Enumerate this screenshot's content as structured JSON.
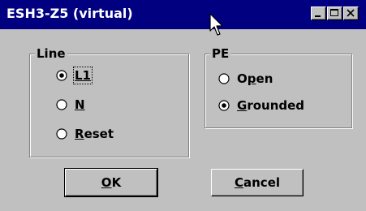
{
  "window": {
    "title": "ESH3-Z5 (virtual)",
    "controls": [
      "minimize-icon",
      "maximize-icon",
      "close-icon"
    ]
  },
  "line_group": {
    "title": "Line",
    "options": [
      {
        "prefix": "",
        "mnemonic": "L1",
        "suffix": "",
        "selected": true
      },
      {
        "prefix": "",
        "mnemonic": "N",
        "suffix": "",
        "selected": false
      },
      {
        "prefix": "",
        "mnemonic": "R",
        "suffix": "eset",
        "selected": false
      }
    ]
  },
  "pe_group": {
    "title": "PE",
    "options": [
      {
        "prefix": "O",
        "mnemonic": "p",
        "suffix": "en",
        "selected": false
      },
      {
        "prefix": "",
        "mnemonic": "G",
        "suffix": "rounded",
        "selected": true
      }
    ]
  },
  "buttons": {
    "ok": {
      "mnemonic": "O",
      "rest": "K"
    },
    "cancel": {
      "mnemonic": "C",
      "rest": "ancel"
    }
  },
  "colors": {
    "title_bar": "#000080",
    "face": "#c0c0c0"
  }
}
